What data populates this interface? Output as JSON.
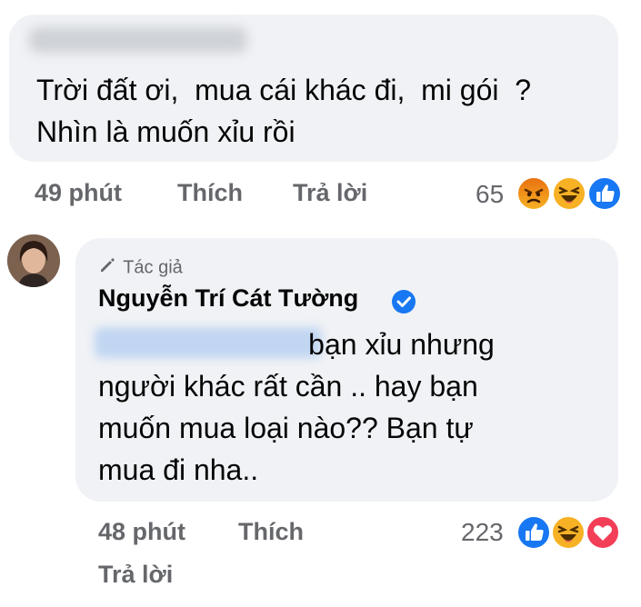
{
  "comment1": {
    "text": "Trời đất ơi,  mua cái khác đi,  mi gói  ?\nNhìn là muốn xỉu rồi",
    "time": "49 phút",
    "like_label": "Thích",
    "reply_label": "Trả lời",
    "reaction_count": "65",
    "reactions": [
      "angry-reaction-icon",
      "haha-reaction-icon",
      "like-reaction-icon"
    ]
  },
  "reply": {
    "author_badge": "Tác giả",
    "author_name": "Nguyễn Trí Cát Tường",
    "text": "                          bạn xỉu nhưng\nngười khác rất cần .. hay bạn\nmuốn mua loại nào?? Bạn tự\nmua đi nha..",
    "time": "48 phút",
    "like_label": "Thích",
    "reply_label": "Trả lời",
    "reaction_count": "223",
    "reactions": [
      "like-reaction-icon",
      "haha-reaction-icon",
      "love-reaction-icon"
    ]
  },
  "colors": {
    "bubble": "#f0f2f5",
    "meta_text": "#65676b",
    "like_blue": "#1877f2",
    "love_red": "#f33e58",
    "haha_yellow": "#f7b125",
    "angry_orange": "#e9710f"
  }
}
